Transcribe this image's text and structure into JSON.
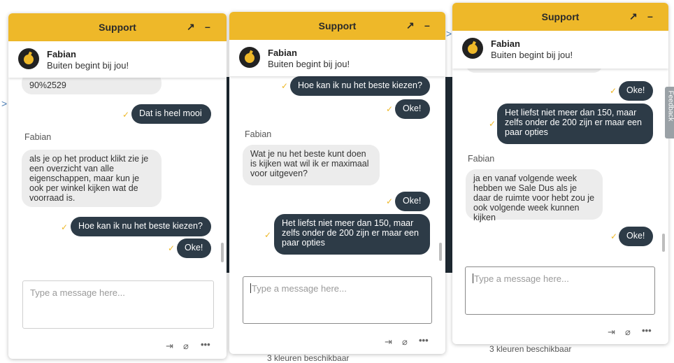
{
  "background": {
    "stock_text": "3 kleuren beschikbaar",
    "feedback_label": "Feedback"
  },
  "panels": [
    {
      "header": {
        "title": "Support",
        "expand_icon": "↗",
        "minimize_icon": "–"
      },
      "agent": {
        "name": "Fabian",
        "subtitle": "Buiten begint bij jou!"
      },
      "input_placeholder": "Type a message here...",
      "messages": [
        {
          "kind": "in",
          "text": "90%2529"
        },
        {
          "kind": "out",
          "text": "Dat is heel mooi"
        },
        {
          "kind": "sender",
          "text": "Fabian"
        },
        {
          "kind": "in",
          "text": "als je op het product klikt zie je een overzicht van alle eigenschappen, maar kun je ook per winkel kijken wat de voorraad is."
        },
        {
          "kind": "out",
          "text": "Hoe kan ik nu het beste kiezen?"
        },
        {
          "kind": "out",
          "text": "Oke!"
        }
      ]
    },
    {
      "header": {
        "title": "Support",
        "expand_icon": "↗",
        "minimize_icon": "–"
      },
      "agent": {
        "name": "Fabian",
        "subtitle": "Buiten begint bij jou!"
      },
      "input_placeholder": "Type a message here...",
      "messages": [
        {
          "kind": "out",
          "text": "Hoe kan ik nu het beste kiezen?"
        },
        {
          "kind": "out",
          "text": "Oke!"
        },
        {
          "kind": "sender",
          "text": "Fabian"
        },
        {
          "kind": "in",
          "text": "Wat je nu het beste kunt doen is kijken wat wil ik er maximaal voor uitgeven?"
        },
        {
          "kind": "out",
          "text": "Oke!"
        },
        {
          "kind": "out",
          "text": "Het liefst niet meer dan 150, maar zelfs onder de 200 zijn er maar een paar opties"
        }
      ]
    },
    {
      "header": {
        "title": "Support",
        "expand_icon": "↗",
        "minimize_icon": "–"
      },
      "agent": {
        "name": "Fabian",
        "subtitle": "Buiten begint bij jou!"
      },
      "input_placeholder": "Type a message here...",
      "messages": [
        {
          "kind": "out",
          "text": "Oke!"
        },
        {
          "kind": "out",
          "text": "Het liefst niet meer dan 150, maar zelfs onder de 200 zijn er maar een paar opties"
        },
        {
          "kind": "sender",
          "text": "Fabian"
        },
        {
          "kind": "in",
          "text": "ja en vanaf volgende week hebben we Sale Dus als je daar de ruimte voor hebt zou je ook volgende week kunnen kijken"
        },
        {
          "kind": "out",
          "text": "Oke!"
        }
      ]
    }
  ],
  "icons": {
    "exit": "exit-icon",
    "attach": "paperclip-icon",
    "more": "more-options-icon",
    "check": "checkmark-icon"
  },
  "colors": {
    "header": "#eeb829",
    "outgoing_bubble": "#2d3b47",
    "incoming_bubble": "#ececec"
  }
}
